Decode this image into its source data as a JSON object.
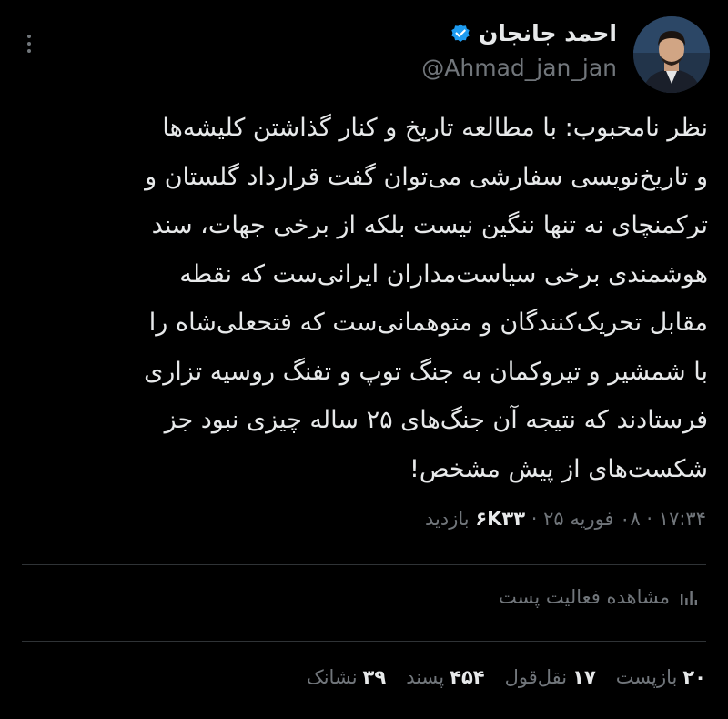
{
  "author": {
    "display_name": "احمد جانجان",
    "handle": "@Ahmad_jan_jan",
    "verified_icon": "verified-badge-icon",
    "verified_color": "#1d9bf0"
  },
  "more_icon": "more-vertical-icon",
  "tweet": {
    "lines": [
      "نظر نامحبوب: با مطالعه تاریخ و کنار گذاشتن کلیشه‌ها",
      "و تاریخ‌نویسی سفارشی می‌توان گفت قرارداد گلستان و",
      "ترکمنچای نه تنها ننگین نیست بلکه از برخی جهات، سند",
      "هوشمندی برخی سیاست‌مداران ایرانی‌ست که نقطه",
      "مقابل تحریک‌کنندگان و متوهمانی‌ست که فتحعلی‌شاه را",
      "با شمشیر و تیروکمان به جنگ توپ و تفنگ روسیه تزاری",
      "فرستادند که نتیجه آن جنگ‌های ۲۵ ساله چیزی نبود جز",
      "شکست‌های از پیش مشخص!"
    ]
  },
  "meta": {
    "time": "۱۷:۳۴",
    "separator": "·",
    "date": "۰۸ فوریه ۲۵",
    "views_count": "۶K۳۳",
    "views_label": "بازدید"
  },
  "activity": {
    "label": "مشاهده فعالیت پست",
    "icon": "bar-chart-icon"
  },
  "stats": [
    {
      "count": "۲۰",
      "label": "بازپست"
    },
    {
      "count": "۱۷",
      "label": "نقل‌قول"
    },
    {
      "count": "۴۵۴",
      "label": "پسند"
    },
    {
      "count": "۳۹",
      "label": "نشانک"
    }
  ],
  "colors": {
    "background": "#000000",
    "text_primary": "#e7e9ea",
    "text_secondary": "#71767b",
    "divider": "#2f3336"
  }
}
